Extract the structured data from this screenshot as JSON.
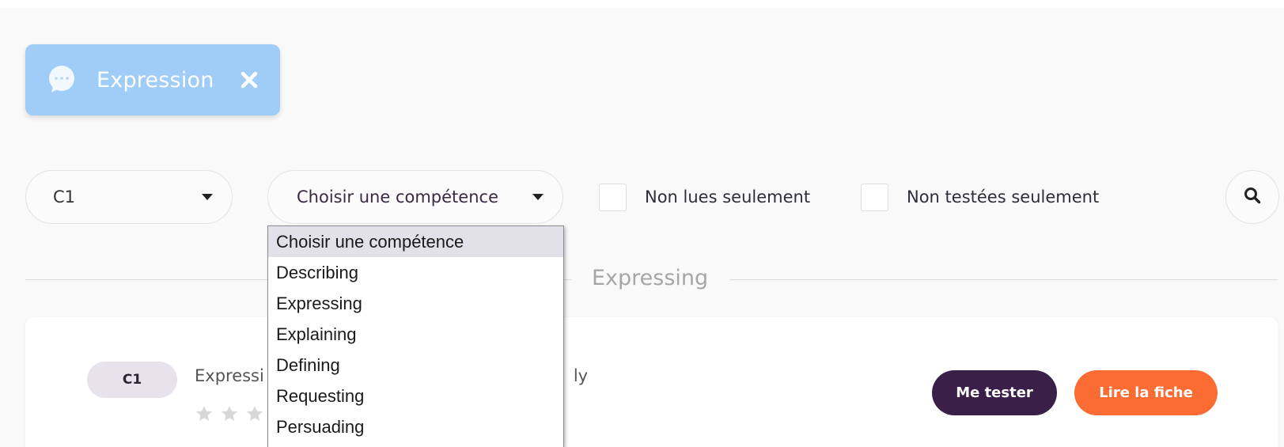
{
  "topic_chip": {
    "label": "Expression",
    "color": "#9fcdf7"
  },
  "filters": {
    "level": "C1",
    "skill": "Choisir une compétence",
    "unread_only_label": "Non lues seulement",
    "untested_only_label": "Non testées seulement"
  },
  "skill_options": [
    "Choisir une compétence",
    "Describing",
    "Expressing",
    "Explaining",
    "Defining",
    "Requesting",
    "Persuading"
  ],
  "section": {
    "title": "Expressing"
  },
  "card": {
    "level": "C1",
    "title_left": "Expressi",
    "title_right": "ly",
    "test_button": "Me tester",
    "read_button": "Lire la fiche",
    "rating": 0
  },
  "colors": {
    "primary_dark": "#3a2048",
    "accent_orange": "#fb6c32",
    "chip_blue": "#9fcdf7"
  },
  "icons": {
    "chip": "speech-bubble-icon",
    "close": "close-icon",
    "search": "search-icon",
    "star": "star-icon"
  }
}
